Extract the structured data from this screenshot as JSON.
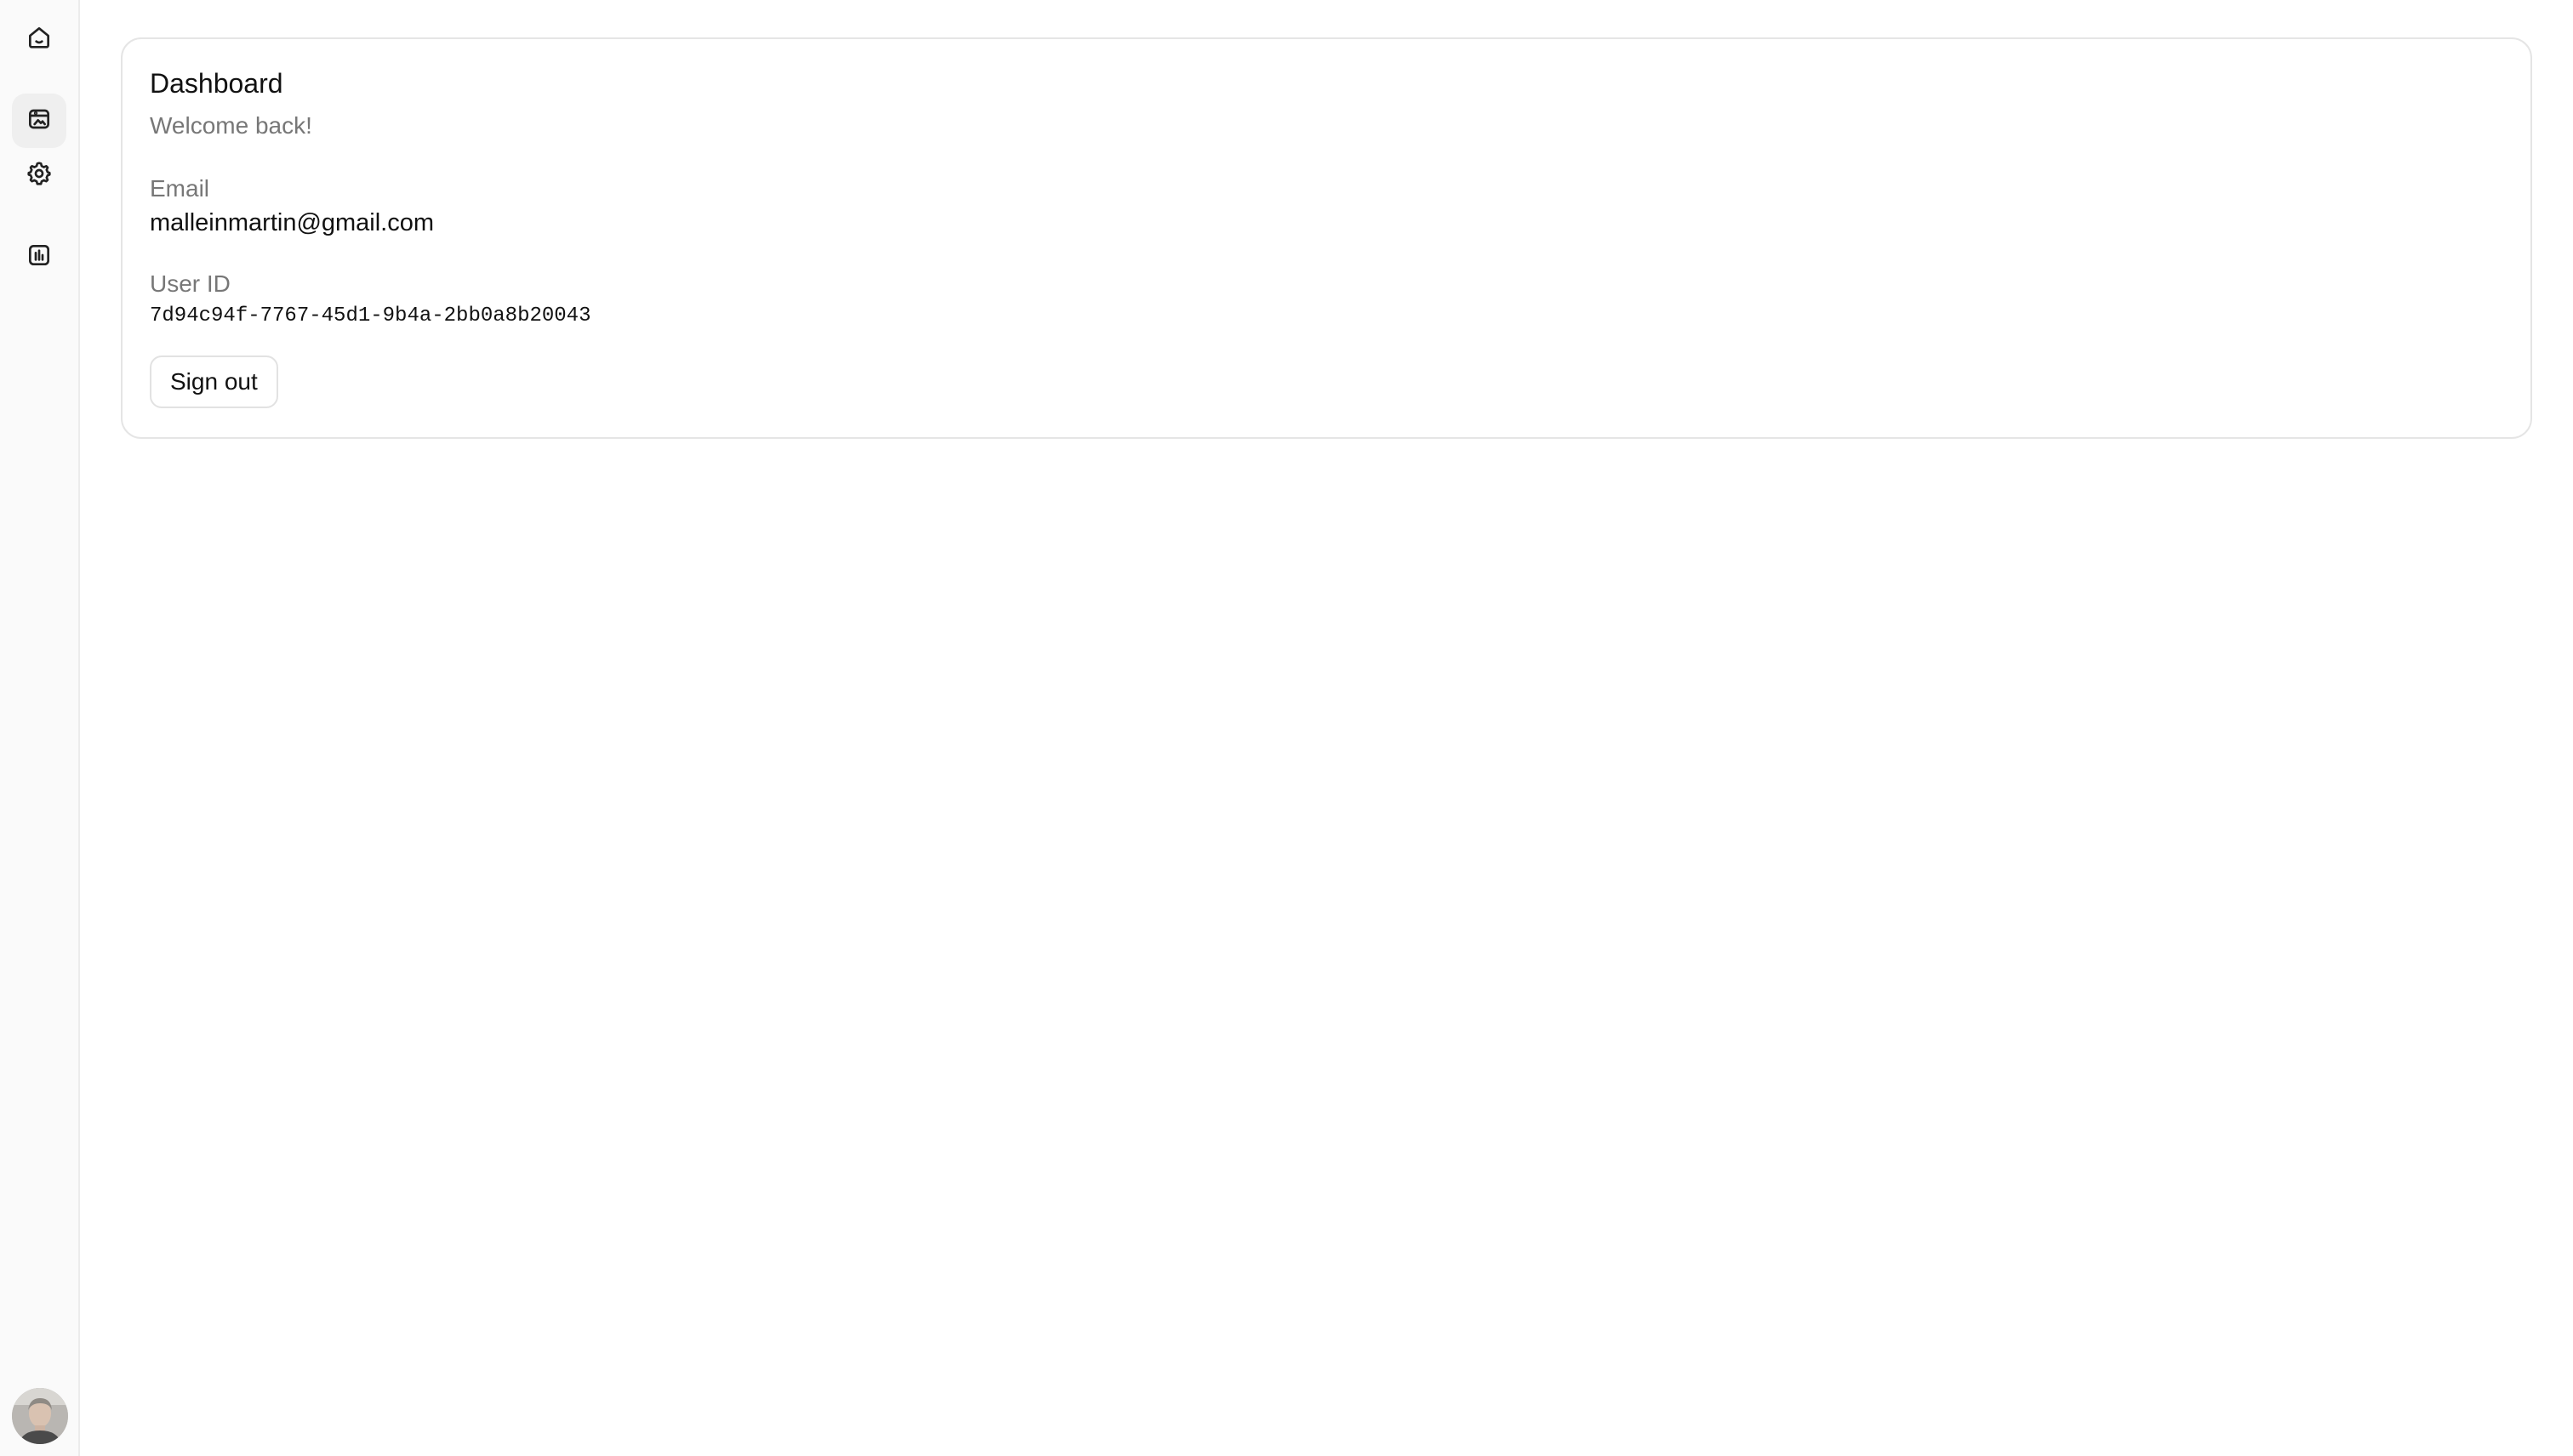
{
  "sidebar": {
    "items": [
      {
        "icon": "home-icon",
        "active": false
      },
      {
        "icon": "gallery-icon",
        "active": true
      },
      {
        "icon": "gear-icon",
        "active": false
      },
      {
        "icon": "bar-chart-icon",
        "active": false
      }
    ],
    "avatar": "user-avatar"
  },
  "dashboard": {
    "title": "Dashboard",
    "subtitle": "Welcome back!",
    "email_label": "Email",
    "email_value": "malleinmartin@gmail.com",
    "user_id_label": "User ID",
    "user_id_value": "7d94c94f-7767-45d1-9b4a-2bb0a8b20043",
    "sign_out_label": "Sign out"
  }
}
